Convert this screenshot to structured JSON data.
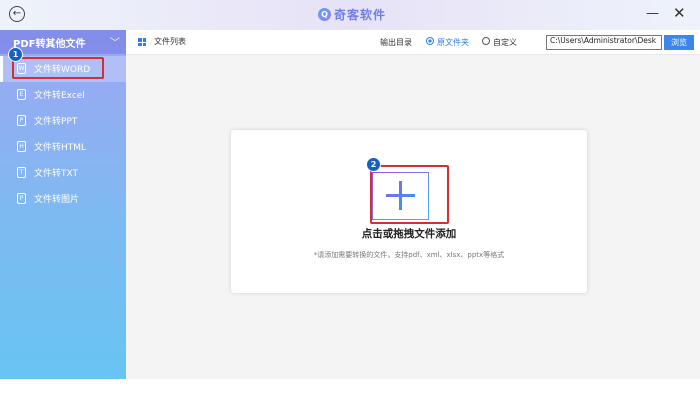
{
  "titlebar": {
    "logo_mark": "Q",
    "logo_text": "奇客软件",
    "minimize_glyph": "—",
    "close_glyph": "✕",
    "back_glyph": "←"
  },
  "sidebar": {
    "header": "PDF转其他文件",
    "chevron": "﹀",
    "items": [
      {
        "label": "文件转WORD",
        "icon": "W",
        "active": true
      },
      {
        "label": "文件转Excel",
        "icon": "E",
        "active": false
      },
      {
        "label": "文件转PPT",
        "icon": "P",
        "active": false
      },
      {
        "label": "文件转HTML",
        "icon": "H",
        "active": false
      },
      {
        "label": "文件转TXT",
        "icon": "T",
        "active": false
      },
      {
        "label": "文件转图片",
        "icon": "P",
        "active": false
      }
    ]
  },
  "toolbar": {
    "list_title": "文件列表",
    "output_label": "输出目录",
    "radio_original": "原文件夹",
    "radio_custom": "自定义",
    "selected": "原文件夹",
    "path_value": "C:\\Users\\Administrator\\Desk",
    "browse_label": "浏览"
  },
  "drop_zone": {
    "title": "点击或拖拽文件添加",
    "hint": "*请添加需要转换的文件，支持pdf、xml、xlsx、pptx等格式"
  },
  "annotations": {
    "badge1": "1",
    "badge2": "2",
    "highlight_color": "#d33030"
  },
  "colors": {
    "accent": "#2f7fe6",
    "sidebar_top": "#9ea6f3",
    "sidebar_bottom": "#67c4f3"
  }
}
